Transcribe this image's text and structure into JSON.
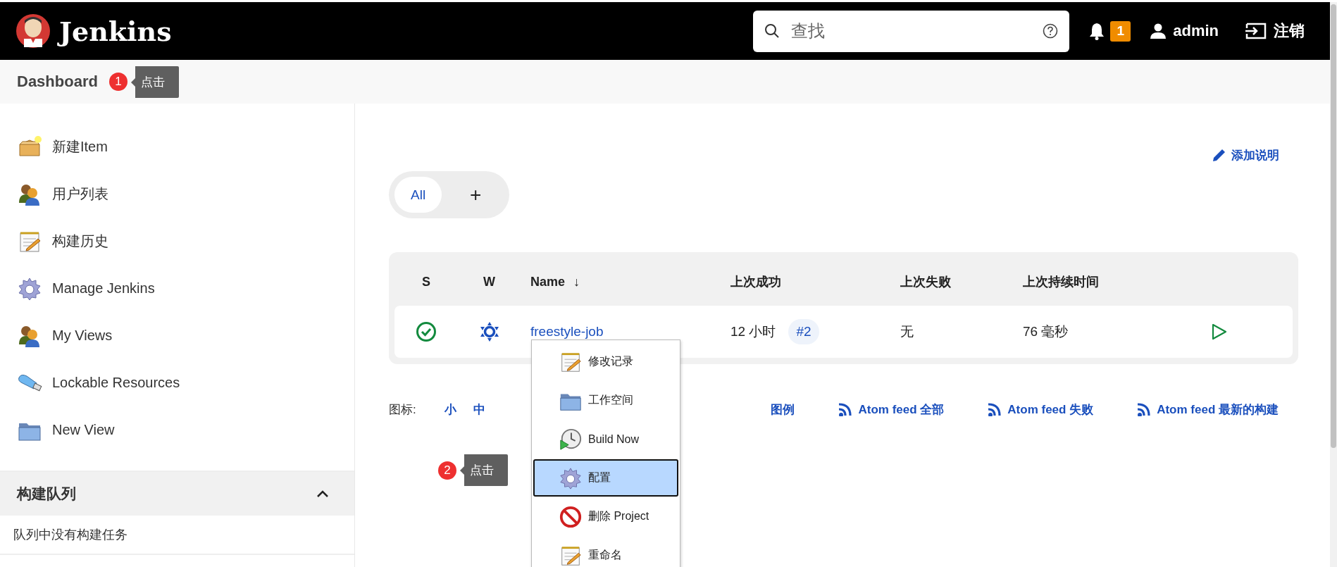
{
  "header": {
    "logo_text": "Jenkins",
    "search": {
      "placeholder": "查找"
    },
    "notification_count": "1",
    "user": "admin",
    "logout": "注销"
  },
  "breadcrumb": {
    "label": "Dashboard"
  },
  "callouts": [
    {
      "number": "1",
      "text": "点击"
    },
    {
      "number": "2",
      "text": "点击"
    }
  ],
  "sidebar": {
    "items": [
      {
        "label": "新建Item",
        "kind": "new-item"
      },
      {
        "label": "用户列表",
        "kind": "people"
      },
      {
        "label": "构建历史",
        "kind": "notepad"
      },
      {
        "label": "Manage Jenkins",
        "kind": "gear"
      },
      {
        "label": "My Views",
        "kind": "people"
      },
      {
        "label": "Lockable Resources",
        "kind": "usb"
      },
      {
        "label": "New View",
        "kind": "folder"
      }
    ]
  },
  "build_queue": {
    "title": "构建队列",
    "expanded": true,
    "empty_text": "队列中没有构建任务"
  },
  "add_description": "添加说明",
  "view_tabs": [
    {
      "label": "All",
      "selected": true
    },
    {
      "label": "+",
      "selected": false
    }
  ],
  "table": {
    "columns": [
      {
        "label": "S"
      },
      {
        "label": "W"
      },
      {
        "label": "Name",
        "sort": "↓"
      },
      {
        "label": "上次成功"
      },
      {
        "label": "上次失败"
      },
      {
        "label": "上次持续时间"
      }
    ],
    "rows": [
      {
        "status": {
          "kind": "success"
        },
        "weather": {
          "kind": "sunny"
        },
        "name": "freestyle-job",
        "last_success": "12 小时",
        "build": "#2",
        "last_failure": "无",
        "duration": "76 毫秒"
      }
    ]
  },
  "icon_size": {
    "label": "图标:",
    "options": [
      {
        "label": "小",
        "selected": false
      },
      {
        "label": "中",
        "selected": false
      }
    ]
  },
  "links": [
    {
      "label": "图例",
      "kind": "plain"
    },
    {
      "label": "Atom feed 全部",
      "kind": "feed"
    },
    {
      "label": "Atom feed 失败",
      "kind": "feed"
    },
    {
      "label": "Atom feed 最新的构建",
      "kind": "feed"
    }
  ],
  "context_menu": {
    "items": [
      {
        "label": "修改记录",
        "kind": "notepad",
        "selected": false
      },
      {
        "label": "工作空间",
        "kind": "folder",
        "selected": false
      },
      {
        "label": "Build Now",
        "kind": "build",
        "selected": false
      },
      {
        "label": "配置",
        "kind": "gear",
        "selected": true
      },
      {
        "label": "删除 Project",
        "kind": "delete",
        "selected": false
      },
      {
        "label": "重命名",
        "kind": "notepad",
        "selected": false
      }
    ]
  }
}
